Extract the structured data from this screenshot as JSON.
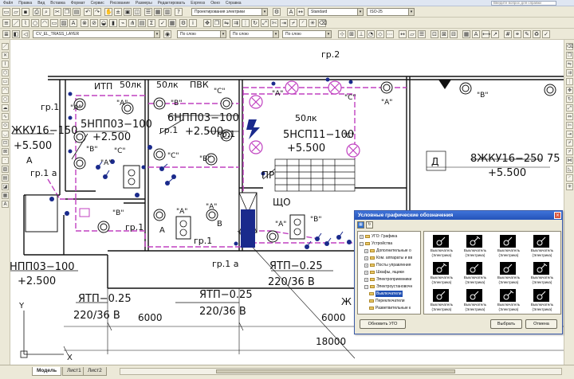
{
  "menubar": {
    "items": [
      "Файл",
      "Правка",
      "Вид",
      "Вставка",
      "Формат",
      "Сервис",
      "Рисование",
      "Размеры",
      "Редактировать",
      "Express",
      "Окно",
      "Справка"
    ],
    "ask_placeholder": "Введите вопрос для справки"
  },
  "toolbar": {
    "layer_combo": "Проектирования электрики",
    "layer_name": "CV_EL_TRASS_LAYER",
    "style_combo": "По слою"
  },
  "icons": {
    "new": "new-file-icon",
    "open": "open-folder-icon",
    "save": "save-disk-icon",
    "print": "printer-icon",
    "undo": "undo-icon",
    "redo": "redo-icon",
    "pan": "pan-hand-icon",
    "zoom": "zoom-icon",
    "layer": "layer-icon",
    "line": "line-icon",
    "circle": "circle-icon",
    "move": "move-icon"
  },
  "drawing": {
    "texts": {
      "gr2": "гр.2",
      "gr1_a": "гр.1",
      "gr1_b": "гр.1",
      "gr1_c": "гр.1",
      "gr1_d": "гр.1",
      "gr1_e": "гр.1",
      "gr1_f": "гр.1 а",
      "itp": "ИТП",
      "lk50_a": "50лк",
      "lk50_b": "50лк",
      "lk50_c": "50лк",
      "pvk": "ПВК",
      "npp5": "5НПП03−100",
      "npp6": "6НПП03−100",
      "nsp5": "5НСП11−100",
      "elev_a": "+2.500",
      "elev_b": "+2.500",
      "elev_c": "+5.500",
      "elev_d": "+5.500",
      "elev_e": "+5.500",
      "elev_f": "+2.500",
      "zhku_left": "ЖКУ16−150",
      "zhku_right": "8ЖКУ16−250",
      "npp_left": "НПП03−100",
      "pr": "ПР",
      "shcho": "ЩО",
      "ytp_a": "ЯТП−0.25",
      "ytp_b": "ЯТП−0.25",
      "ytp_c": "ЯТП−0.25",
      "v220_a": "220/36 В",
      "v220_b": "220/36 В",
      "dim6000_a": "6000",
      "dim6000_b": "6000",
      "dim18000": "18000",
      "room_d": "Д",
      "seventy_five": "75",
      "zh_cut": "Ж",
      "axis_y": "Y",
      "axis_x": "X",
      "gr_a_label": "гр.1 а",
      "a": "\"А\"",
      "b": "\"В\"",
      "c": "\"С\"",
      "A": "А",
      "B": "В"
    }
  },
  "palette": {
    "title": "Условные графические обозначения",
    "tree": [
      {
        "label": "УГО: Графика",
        "indent": 0,
        "mark": "+"
      },
      {
        "label": "Устройства",
        "indent": 0,
        "mark": "−"
      },
      {
        "label": "Дополнительные о",
        "indent": 1,
        "mark": "+"
      },
      {
        "label": "Ком. аппараты и вв",
        "indent": 1,
        "mark": "+"
      },
      {
        "label": "Посты управления",
        "indent": 1,
        "mark": "+"
      },
      {
        "label": "Шкафы, ящики",
        "indent": 1,
        "mark": "+"
      },
      {
        "label": "Электроприемники",
        "indent": 1,
        "mark": "+"
      },
      {
        "label": "Электроустановочн",
        "indent": 1,
        "mark": "−"
      },
      {
        "label": "Выключатели",
        "indent": 2,
        "mark": "",
        "selected": true
      },
      {
        "label": "Переключатели",
        "indent": 2,
        "mark": ""
      },
      {
        "label": "Разветвительные к",
        "indent": 2,
        "mark": ""
      }
    ],
    "cells": [
      "Выключатель (Электрика)",
      "Выключатель (Электрика)",
      "Выключатель (Электрика)",
      "Выключатель (Электрика)",
      "Выключатель (Электрика)",
      "Выключатель (Электрика)",
      "Выключатель (Электрика)",
      "Выключатель (Электрика)",
      "Выключатель (Электрика)",
      "Выключатель (Электрика)",
      "Выключатель (Электрика)",
      "Выключатель (Электрика)"
    ],
    "buttons": {
      "update": "Обновить УГО",
      "select": "Выбрать",
      "cancel": "Отмена"
    }
  },
  "tabs": [
    "Модель",
    "Лист1",
    "Лист2"
  ],
  "colors": {
    "wire": "#c040c0",
    "fixture_fill": "#ffffff",
    "equipment": "#1a2a8c",
    "titlebar": "#2453b8"
  }
}
